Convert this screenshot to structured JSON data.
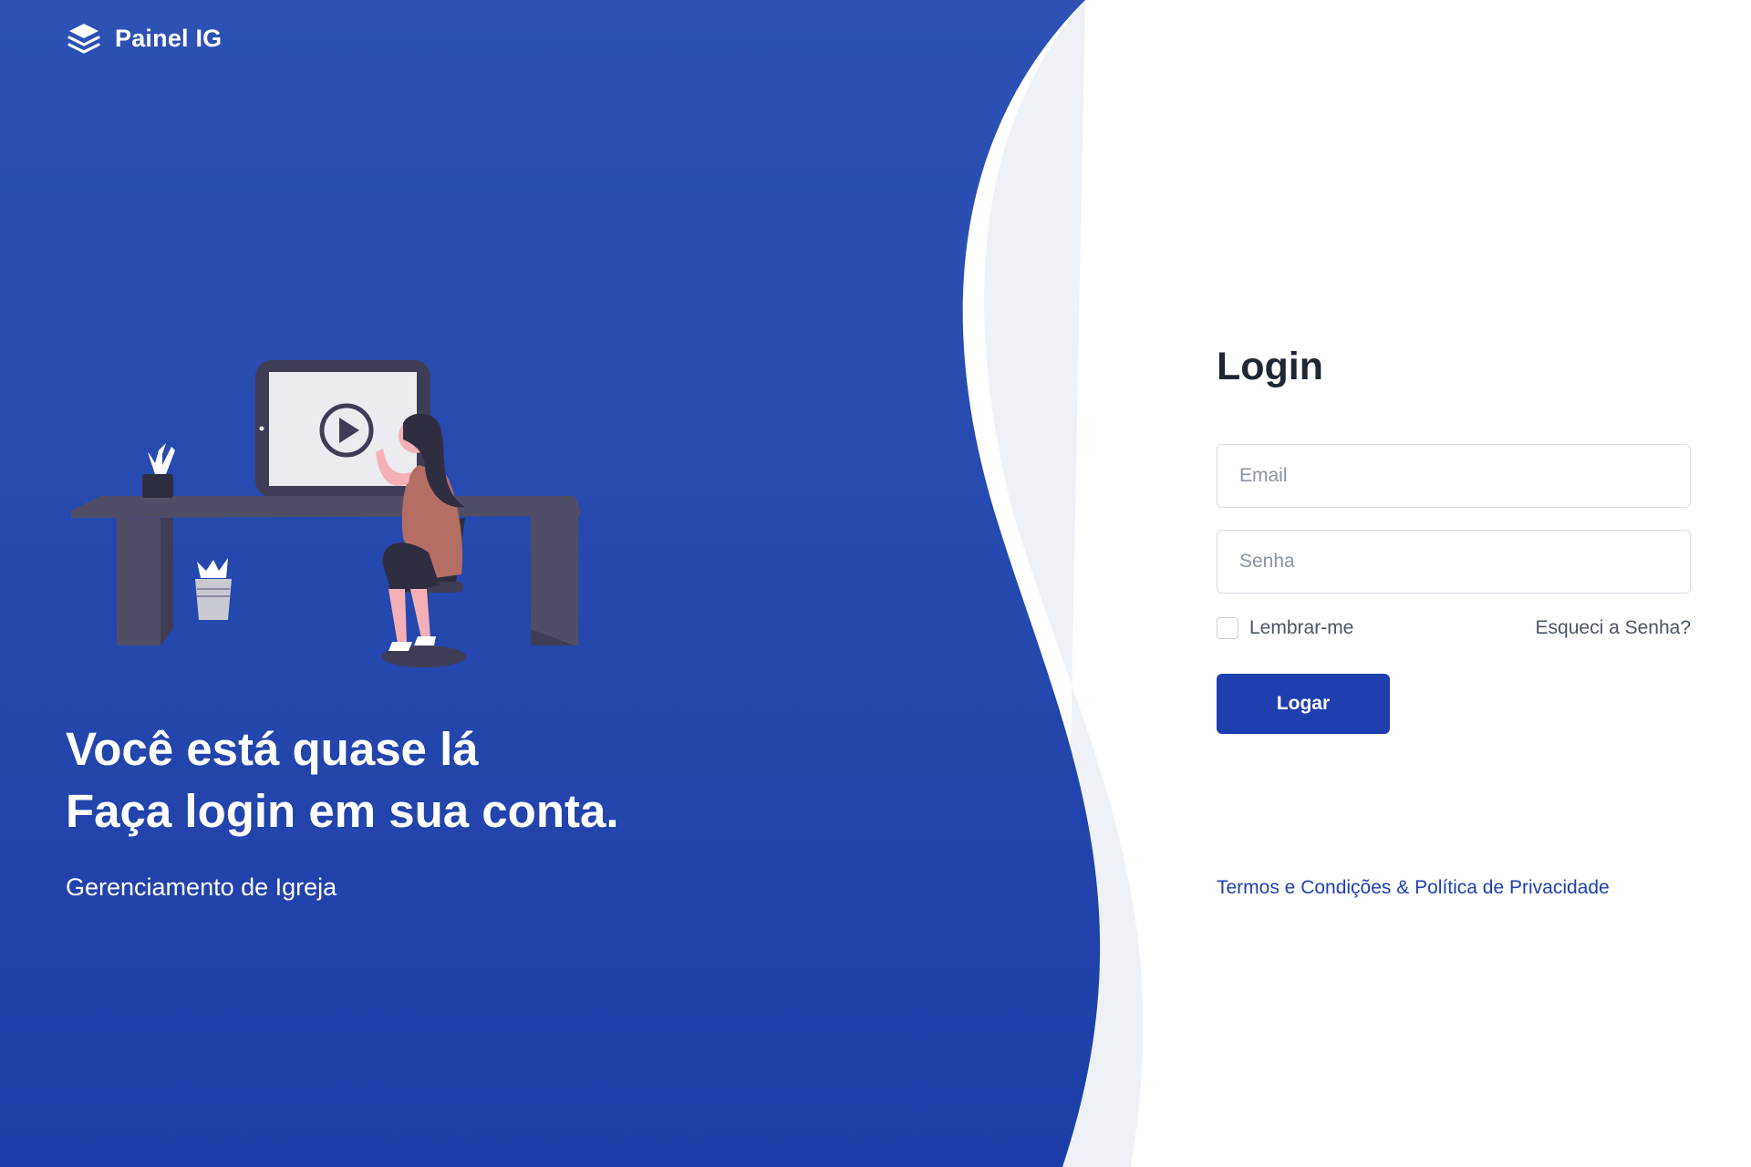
{
  "brand": {
    "name": "Painel IG",
    "icon": "layers-icon"
  },
  "hero": {
    "title_line1": "Você está quase lá",
    "title_line2": "Faça login em sua conta.",
    "subtitle": "Gerenciamento de Igreja"
  },
  "login": {
    "title": "Login",
    "email_placeholder": "Email",
    "password_placeholder": "Senha",
    "remember_label": "Lembrar-me",
    "forgot_label": "Esqueci a Senha?",
    "submit_label": "Logar",
    "terms_label": "Termos e Condições & Política de Privacidade"
  },
  "colors": {
    "panel_top": "#2d52b4",
    "panel_bottom": "#1d3ea8",
    "accent": "#1e40af",
    "title_text": "#1e2733"
  }
}
